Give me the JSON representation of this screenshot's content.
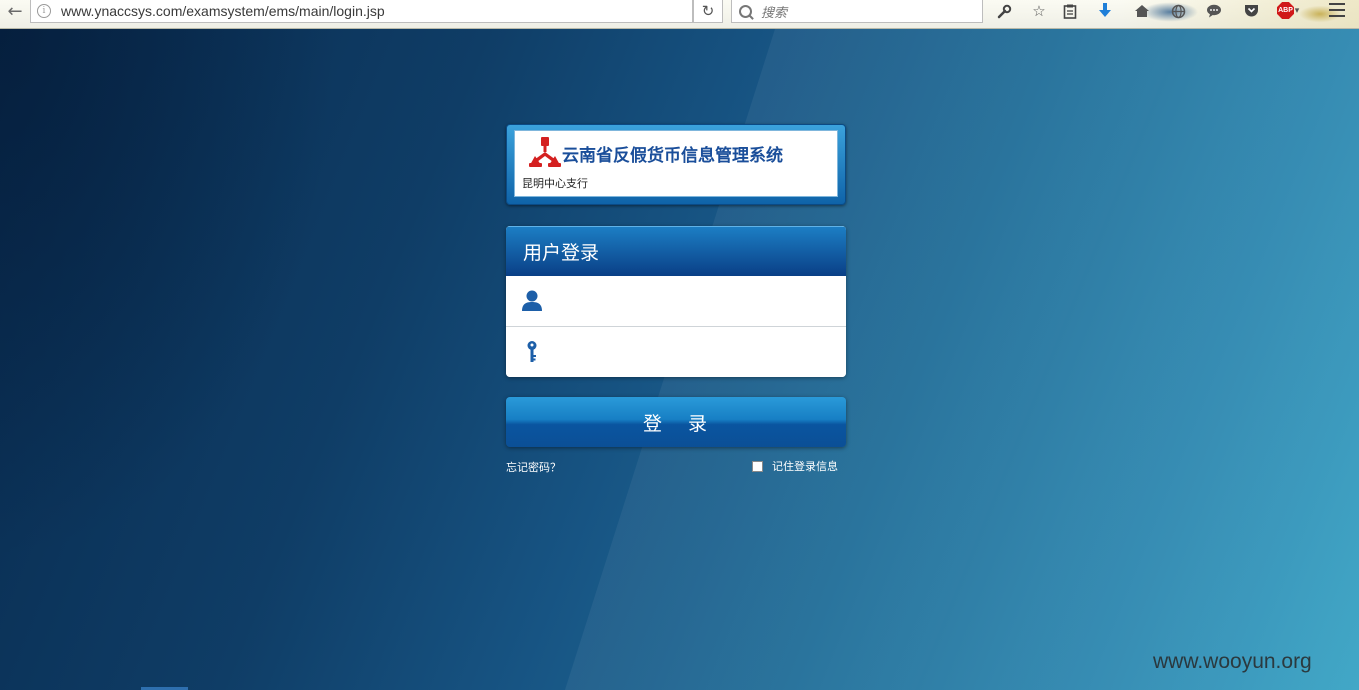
{
  "browser": {
    "url": "www.ynaccsys.com/examsystem/ems/main/login.jsp",
    "search_placeholder": "搜索",
    "adblock_badge": "ABP",
    "icons": [
      "back-icon",
      "info-icon",
      "reload-icon",
      "search-icon",
      "wrench-icon",
      "star-icon",
      "clipboard-icon",
      "download-icon",
      "home-icon",
      "globe-icon",
      "chat-icon",
      "pocket-icon",
      "adblock-icon",
      "menu-icon"
    ]
  },
  "brand": {
    "title": "云南省反假货币信息管理系统",
    "subtitle": "昆明中心支行",
    "logo": "pboc-logo",
    "logo_color": "#d42020"
  },
  "login": {
    "title": "用户登录",
    "username_icon": "user-icon",
    "password_icon": "key-icon",
    "username_value": "",
    "password_value": "",
    "submit_label": "登 录",
    "forgot_label": "忘记密码？",
    "remember_label": "记住登录信息",
    "remember_checked": false
  },
  "watermark": "www.wooyun.org",
  "colors": {
    "accent": "#0a4a9a",
    "header_gradient_top": "#1c7ec4",
    "header_gradient_bottom": "#0a3f86",
    "background_dark": "#082a4e",
    "background_light": "#3aa4c5"
  }
}
